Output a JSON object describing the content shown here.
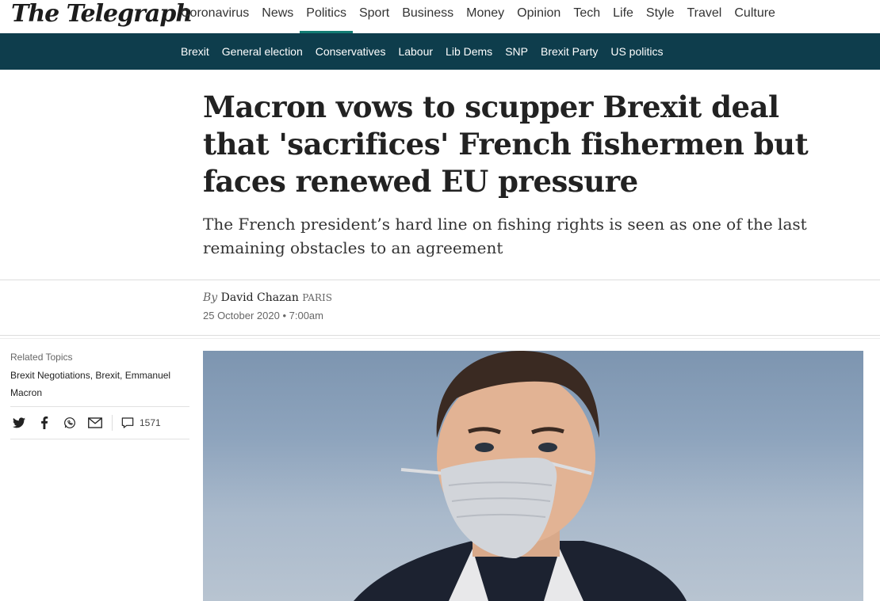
{
  "brand": {
    "logo_text": "The Telegraph"
  },
  "main_nav": [
    {
      "label": "Coronavirus"
    },
    {
      "label": "News"
    },
    {
      "label": "Politics",
      "active": true
    },
    {
      "label": "Sport"
    },
    {
      "label": "Business"
    },
    {
      "label": "Money"
    },
    {
      "label": "Opinion"
    },
    {
      "label": "Tech"
    },
    {
      "label": "Life"
    },
    {
      "label": "Style"
    },
    {
      "label": "Travel"
    },
    {
      "label": "Culture"
    }
  ],
  "sub_nav": [
    {
      "label": "Brexit"
    },
    {
      "label": "General election"
    },
    {
      "label": "Conservatives"
    },
    {
      "label": "Labour"
    },
    {
      "label": "Lib Dems"
    },
    {
      "label": "SNP"
    },
    {
      "label": "Brexit Party"
    },
    {
      "label": "US politics"
    }
  ],
  "article": {
    "headline": "Macron vows to scupper Brexit deal that 'sacrifices' French fishermen but faces renewed EU pressure",
    "standfirst": "The French president’s hard line on fishing rights is seen as one of the last remaining obstacles to an agreement",
    "byline_prefix": "By",
    "author": "David Chazan",
    "location": "Paris",
    "date": "25 October 2020 • 7:00am"
  },
  "sidebar": {
    "related_label": "Related Topics",
    "related_topics": "Brexit Negotiations, Brexit, Emmanuel Macron",
    "share_icons": [
      "twitter-icon",
      "facebook-icon",
      "whatsapp-icon",
      "email-icon"
    ],
    "comment_count": "1571"
  },
  "colors": {
    "accent": "#137c73",
    "subnav_bg": "#0e3d4c"
  }
}
